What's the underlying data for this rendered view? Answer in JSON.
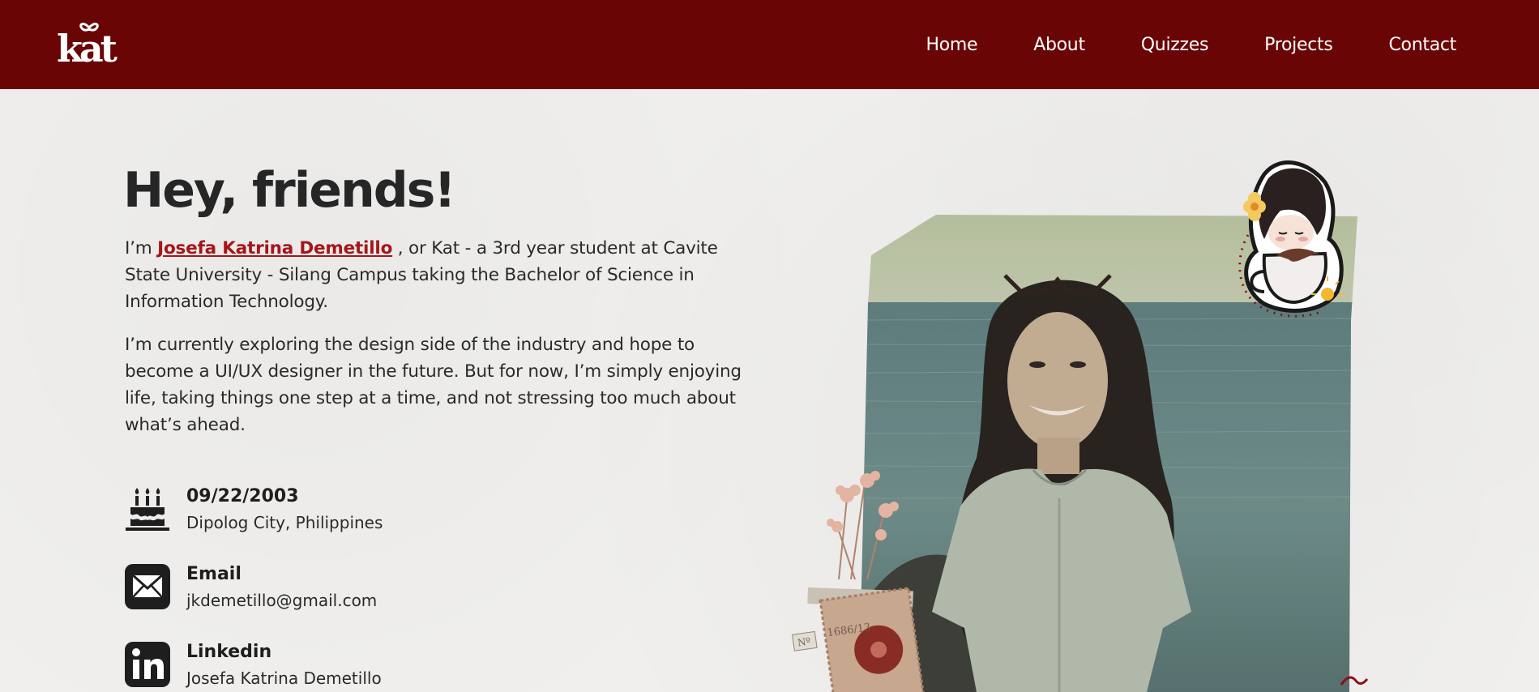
{
  "header": {
    "logo_text": "kat",
    "nav": [
      "Home",
      "About",
      "Quizzes",
      "Projects",
      "Contact"
    ]
  },
  "hero": {
    "title": "Hey, friends!",
    "intro_prefix": "I’m ",
    "intro_name": "Josefa Katrina Demetillo",
    "intro_suffix": " , or Kat - a 3rd year student at Cavite State University - Silang Campus taking the Bachelor of Science in Information Technology.",
    "paragraph2": "I’m currently exploring the design side of the industry and hope to become a UI/UX designer in the future. But for now, I’m simply enjoying life, taking things one step at a time, and not stressing too much about what’s ahead."
  },
  "info": [
    {
      "icon": "birthday-cake-icon",
      "title": "09/22/2003",
      "subtitle": "Dipolog City, Philippines"
    },
    {
      "icon": "mail-icon",
      "title": "Email",
      "subtitle": "jkdemetillo@gmail.com"
    },
    {
      "icon": "linkedin-icon",
      "title": "Linkedin",
      "subtitle": "Josefa Katrina Demetillo"
    }
  ],
  "stamp": {
    "label": "Nº",
    "number": "1686/13"
  },
  "colors": {
    "brand": "#6a0506",
    "accent": "#a3161a",
    "background": "#efeeec"
  }
}
